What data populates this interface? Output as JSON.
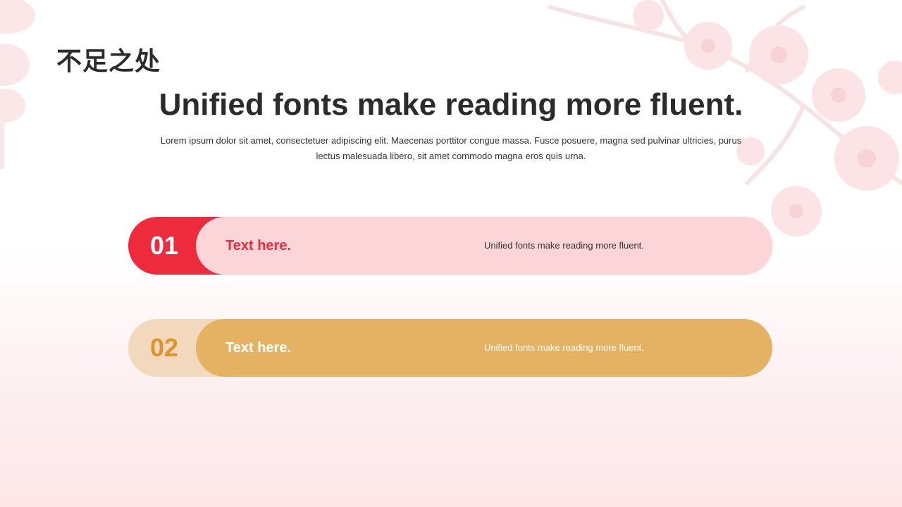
{
  "page": {
    "title": "不足之处",
    "headline": "Unified fonts make reading more fluent.",
    "body": "Lorem ipsum dolor sit amet, consectetuer adipiscing elit. Maecenas porttitor congue massa. Fusce posuere, magna sed pulvinar ultricies, purus lectus malesuada libero, sit amet commodo magna eros quis urna."
  },
  "items": [
    {
      "number": "01",
      "label": "Text here.",
      "description": "Unified fonts make reading more fluent.",
      "accent": "#ee2a3d",
      "bar_color": "#fcd5d9"
    },
    {
      "number": "02",
      "label": "Text here.",
      "description": "Unified fonts make reading more fluent.",
      "accent": "#e0922e",
      "bar_color": "#e5b162"
    }
  ],
  "decor": {
    "top_right": "plum-blossom-icon",
    "top_left": "lantern-icon"
  }
}
